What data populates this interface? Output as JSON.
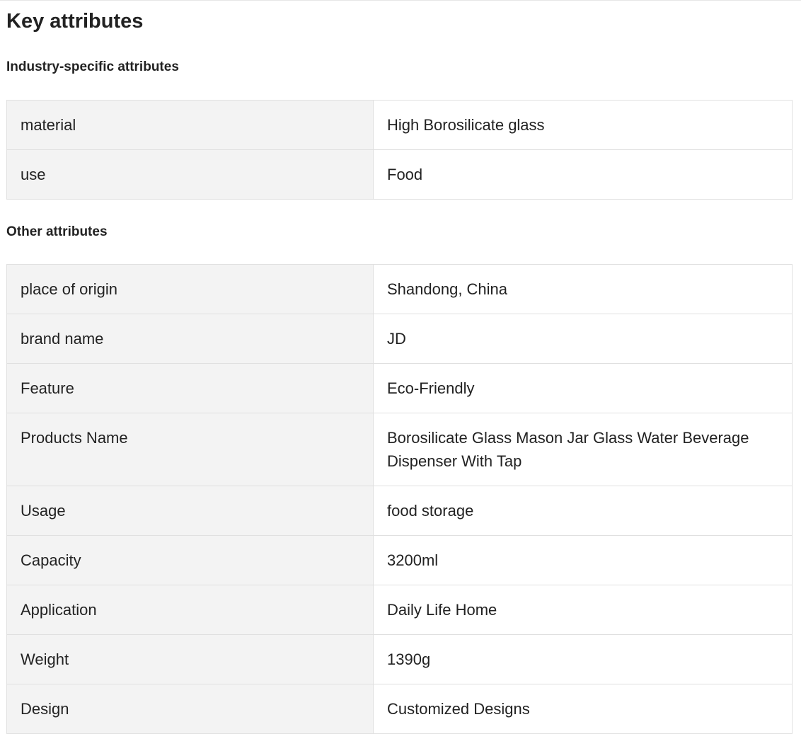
{
  "page_title": "Key attributes",
  "industry_section": {
    "title": "Industry-specific attributes",
    "rows": [
      {
        "key": "material",
        "value": "High Borosilicate glass"
      },
      {
        "key": "use",
        "value": "Food"
      }
    ]
  },
  "other_section": {
    "title": "Other attributes",
    "rows": [
      {
        "key": "place of origin",
        "value": "Shandong, China"
      },
      {
        "key": "brand name",
        "value": "JD"
      },
      {
        "key": "Feature",
        "value": "Eco-Friendly"
      },
      {
        "key": "Products Name",
        "value": "Borosilicate Glass Mason Jar Glass Water Beverage Dispenser With Tap"
      },
      {
        "key": "Usage",
        "value": "food storage"
      },
      {
        "key": "Capacity",
        "value": "3200ml"
      },
      {
        "key": "Application",
        "value": "Daily Life Home"
      },
      {
        "key": "Weight",
        "value": "1390g"
      },
      {
        "key": "Design",
        "value": "Customized Designs"
      }
    ]
  }
}
